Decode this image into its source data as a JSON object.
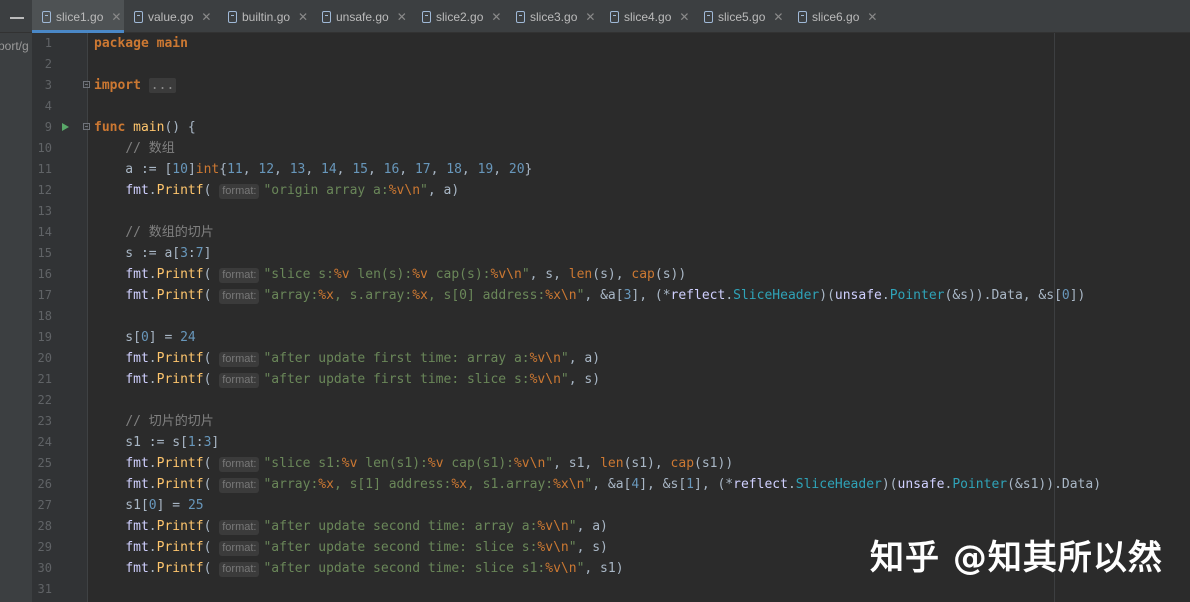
{
  "tabs": [
    {
      "name": "slice1.go",
      "active": true
    },
    {
      "name": "value.go"
    },
    {
      "name": "builtin.go"
    },
    {
      "name": "unsafe.go"
    },
    {
      "name": "slice2.go"
    },
    {
      "name": "slice3.go"
    },
    {
      "name": "slice4.go"
    },
    {
      "name": "slice5.go"
    },
    {
      "name": "slice6.go"
    }
  ],
  "project_panel_text": "port/g",
  "line_numbers": [
    "1",
    "2",
    "3",
    "4",
    "9",
    "10",
    "11",
    "12",
    "13",
    "14",
    "15",
    "16",
    "17",
    "18",
    "19",
    "20",
    "21",
    "22",
    "23",
    "24",
    "25",
    "26",
    "27",
    "28",
    "29",
    "30",
    "31"
  ],
  "code_lines": [
    {
      "ln": "1",
      "tokens": [
        [
          "kw",
          "package"
        ],
        [
          "id",
          " "
        ],
        [
          "kw",
          "main"
        ]
      ]
    },
    {
      "ln": "2",
      "tokens": []
    },
    {
      "ln": "3",
      "fold": true,
      "tokens": [
        [
          "kw",
          "import"
        ],
        [
          "id",
          " "
        ],
        [
          "folded",
          "..."
        ]
      ]
    },
    {
      "ln": "4",
      "tokens": []
    },
    {
      "ln": "9",
      "fold": true,
      "run": true,
      "tokens": [
        [
          "kw",
          "func"
        ],
        [
          "id",
          " "
        ],
        [
          "fn",
          "main"
        ],
        [
          "id",
          "() {"
        ]
      ]
    },
    {
      "ln": "10",
      "tokens": [
        [
          "id",
          "    "
        ],
        [
          "cmt",
          "// 数组"
        ]
      ]
    },
    {
      "ln": "11",
      "tokens": [
        [
          "id",
          "    a := ["
        ],
        [
          "num",
          "10"
        ],
        [
          "id",
          "]"
        ],
        [
          "kwn",
          "int"
        ],
        [
          "id",
          "{"
        ],
        [
          "num",
          "11"
        ],
        [
          "id",
          ", "
        ],
        [
          "num",
          "12"
        ],
        [
          "id",
          ", "
        ],
        [
          "num",
          "13"
        ],
        [
          "id",
          ", "
        ],
        [
          "num",
          "14"
        ],
        [
          "id",
          ", "
        ],
        [
          "num",
          "15"
        ],
        [
          "id",
          ", "
        ],
        [
          "num",
          "16"
        ],
        [
          "id",
          ", "
        ],
        [
          "num",
          "17"
        ],
        [
          "id",
          ", "
        ],
        [
          "num",
          "18"
        ],
        [
          "id",
          ", "
        ],
        [
          "num",
          "19"
        ],
        [
          "id",
          ", "
        ],
        [
          "num",
          "20"
        ],
        [
          "id",
          "}"
        ]
      ]
    },
    {
      "ln": "12",
      "tokens": [
        [
          "id",
          "    "
        ],
        [
          "pkg",
          "fmt"
        ],
        [
          "id",
          "."
        ],
        [
          "fn",
          "Printf"
        ],
        [
          "id",
          "( "
        ],
        [
          "hint",
          "format:"
        ],
        [
          "str",
          "\"origin array a:"
        ],
        [
          "esc",
          "%v\\n"
        ],
        [
          "str",
          "\""
        ],
        [
          "id",
          ", a)"
        ]
      ]
    },
    {
      "ln": "13",
      "tokens": []
    },
    {
      "ln": "14",
      "tokens": [
        [
          "id",
          "    "
        ],
        [
          "cmt",
          "// 数组的切片"
        ]
      ]
    },
    {
      "ln": "15",
      "tokens": [
        [
          "id",
          "    s := a["
        ],
        [
          "num",
          "3"
        ],
        [
          "id",
          ":"
        ],
        [
          "num",
          "7"
        ],
        [
          "id",
          "]"
        ]
      ]
    },
    {
      "ln": "16",
      "tokens": [
        [
          "id",
          "    "
        ],
        [
          "pkg",
          "fmt"
        ],
        [
          "id",
          "."
        ],
        [
          "fn",
          "Printf"
        ],
        [
          "id",
          "( "
        ],
        [
          "hint",
          "format:"
        ],
        [
          "str",
          "\"slice s:"
        ],
        [
          "esc",
          "%v"
        ],
        [
          "str",
          " len(s):"
        ],
        [
          "esc",
          "%v"
        ],
        [
          "str",
          " cap(s):"
        ],
        [
          "esc",
          "%v\\n"
        ],
        [
          "str",
          "\""
        ],
        [
          "id",
          ", s, "
        ],
        [
          "kwn",
          "len"
        ],
        [
          "id",
          "(s), "
        ],
        [
          "kwn",
          "cap"
        ],
        [
          "id",
          "(s))"
        ]
      ]
    },
    {
      "ln": "17",
      "tokens": [
        [
          "id",
          "    "
        ],
        [
          "pkg",
          "fmt"
        ],
        [
          "id",
          "."
        ],
        [
          "fn",
          "Printf"
        ],
        [
          "id",
          "( "
        ],
        [
          "hint",
          "format:"
        ],
        [
          "str",
          "\"array:"
        ],
        [
          "esc",
          "%x"
        ],
        [
          "str",
          ", s.array:"
        ],
        [
          "esc",
          "%x"
        ],
        [
          "str",
          ", s[0] address:"
        ],
        [
          "esc",
          "%x\\n"
        ],
        [
          "str",
          "\""
        ],
        [
          "id",
          ", &a["
        ],
        [
          "num",
          "3"
        ],
        [
          "id",
          "], (*"
        ],
        [
          "pkg",
          "reflect"
        ],
        [
          "id",
          "."
        ],
        [
          "typ",
          "SliceHeader"
        ],
        [
          "id",
          ")("
        ],
        [
          "pkg",
          "unsafe"
        ],
        [
          "id",
          "."
        ],
        [
          "typ",
          "Pointer"
        ],
        [
          "id",
          "(&s)).Data, &s["
        ],
        [
          "num",
          "0"
        ],
        [
          "id",
          "])"
        ]
      ]
    },
    {
      "ln": "18",
      "tokens": []
    },
    {
      "ln": "19",
      "tokens": [
        [
          "id",
          "    s["
        ],
        [
          "num",
          "0"
        ],
        [
          "id",
          "] = "
        ],
        [
          "num",
          "24"
        ]
      ]
    },
    {
      "ln": "20",
      "tokens": [
        [
          "id",
          "    "
        ],
        [
          "pkg",
          "fmt"
        ],
        [
          "id",
          "."
        ],
        [
          "fn",
          "Printf"
        ],
        [
          "id",
          "( "
        ],
        [
          "hint",
          "format:"
        ],
        [
          "str",
          "\"after update first time: array a:"
        ],
        [
          "esc",
          "%v\\n"
        ],
        [
          "str",
          "\""
        ],
        [
          "id",
          ", a)"
        ]
      ]
    },
    {
      "ln": "21",
      "tokens": [
        [
          "id",
          "    "
        ],
        [
          "pkg",
          "fmt"
        ],
        [
          "id",
          "."
        ],
        [
          "fn",
          "Printf"
        ],
        [
          "id",
          "( "
        ],
        [
          "hint",
          "format:"
        ],
        [
          "str",
          "\"after update first time: slice s:"
        ],
        [
          "esc",
          "%v\\n"
        ],
        [
          "str",
          "\""
        ],
        [
          "id",
          ", s)"
        ]
      ]
    },
    {
      "ln": "22",
      "tokens": []
    },
    {
      "ln": "23",
      "tokens": [
        [
          "id",
          "    "
        ],
        [
          "cmt",
          "// 切片的切片"
        ]
      ]
    },
    {
      "ln": "24",
      "tokens": [
        [
          "id",
          "    s1 := s["
        ],
        [
          "num",
          "1"
        ],
        [
          "id",
          ":"
        ],
        [
          "num",
          "3"
        ],
        [
          "id",
          "]"
        ]
      ]
    },
    {
      "ln": "25",
      "tokens": [
        [
          "id",
          "    "
        ],
        [
          "pkg",
          "fmt"
        ],
        [
          "id",
          "."
        ],
        [
          "fn",
          "Printf"
        ],
        [
          "id",
          "( "
        ],
        [
          "hint",
          "format:"
        ],
        [
          "str",
          "\"slice s1:"
        ],
        [
          "esc",
          "%v"
        ],
        [
          "str",
          " len(s1):"
        ],
        [
          "esc",
          "%v"
        ],
        [
          "str",
          " cap(s1):"
        ],
        [
          "esc",
          "%v\\n"
        ],
        [
          "str",
          "\""
        ],
        [
          "id",
          ", s1, "
        ],
        [
          "kwn",
          "len"
        ],
        [
          "id",
          "(s1), "
        ],
        [
          "kwn",
          "cap"
        ],
        [
          "id",
          "(s1))"
        ]
      ]
    },
    {
      "ln": "26",
      "tokens": [
        [
          "id",
          "    "
        ],
        [
          "pkg",
          "fmt"
        ],
        [
          "id",
          "."
        ],
        [
          "fn",
          "Printf"
        ],
        [
          "id",
          "( "
        ],
        [
          "hint",
          "format:"
        ],
        [
          "str",
          "\"array:"
        ],
        [
          "esc",
          "%x"
        ],
        [
          "str",
          ", s[1] address:"
        ],
        [
          "esc",
          "%x"
        ],
        [
          "str",
          ", s1.array:"
        ],
        [
          "esc",
          "%x\\n"
        ],
        [
          "str",
          "\""
        ],
        [
          "id",
          ", &a["
        ],
        [
          "num",
          "4"
        ],
        [
          "id",
          "], &s["
        ],
        [
          "num",
          "1"
        ],
        [
          "id",
          "], (*"
        ],
        [
          "pkg",
          "reflect"
        ],
        [
          "id",
          "."
        ],
        [
          "typ",
          "SliceHeader"
        ],
        [
          "id",
          ")("
        ],
        [
          "pkg",
          "unsafe"
        ],
        [
          "id",
          "."
        ],
        [
          "typ",
          "Pointer"
        ],
        [
          "id",
          "(&s1)).Data)"
        ]
      ]
    },
    {
      "ln": "27",
      "tokens": [
        [
          "id",
          "    s1["
        ],
        [
          "num",
          "0"
        ],
        [
          "id",
          "] = "
        ],
        [
          "num",
          "25"
        ]
      ]
    },
    {
      "ln": "28",
      "tokens": [
        [
          "id",
          "    "
        ],
        [
          "pkg",
          "fmt"
        ],
        [
          "id",
          "."
        ],
        [
          "fn",
          "Printf"
        ],
        [
          "id",
          "( "
        ],
        [
          "hint",
          "format:"
        ],
        [
          "str",
          "\"after update second time: array a:"
        ],
        [
          "esc",
          "%v\\n"
        ],
        [
          "str",
          "\""
        ],
        [
          "id",
          ", a)"
        ]
      ]
    },
    {
      "ln": "29",
      "tokens": [
        [
          "id",
          "    "
        ],
        [
          "pkg",
          "fmt"
        ],
        [
          "id",
          "."
        ],
        [
          "fn",
          "Printf"
        ],
        [
          "id",
          "( "
        ],
        [
          "hint",
          "format:"
        ],
        [
          "str",
          "\"after update second time: slice s:"
        ],
        [
          "esc",
          "%v\\n"
        ],
        [
          "str",
          "\""
        ],
        [
          "id",
          ", s)"
        ]
      ]
    },
    {
      "ln": "30",
      "tokens": [
        [
          "id",
          "    "
        ],
        [
          "pkg",
          "fmt"
        ],
        [
          "id",
          "."
        ],
        [
          "fn",
          "Printf"
        ],
        [
          "id",
          "( "
        ],
        [
          "hint",
          "format:"
        ],
        [
          "str",
          "\"after update second time: slice s1:"
        ],
        [
          "esc",
          "%v\\n"
        ],
        [
          "str",
          "\""
        ],
        [
          "id",
          ", s1)"
        ]
      ]
    },
    {
      "ln": "31",
      "tokens": []
    }
  ],
  "watermark": "知乎 @知其所以然"
}
